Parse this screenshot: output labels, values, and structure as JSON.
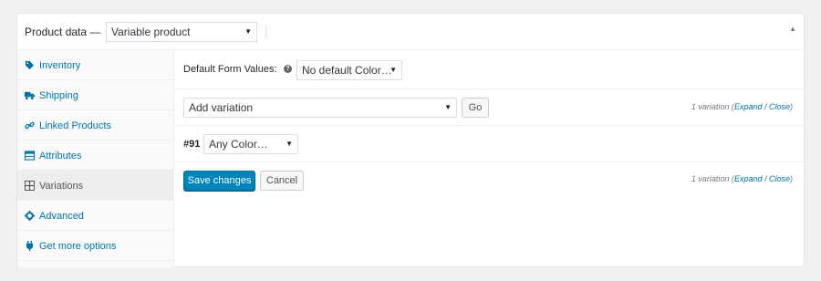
{
  "header": {
    "title": "Product data —",
    "product_type": "Variable product"
  },
  "sidebar": {
    "items": [
      {
        "label": "Inventory",
        "icon": "tag-icon"
      },
      {
        "label": "Shipping",
        "icon": "truck-icon"
      },
      {
        "label": "Linked Products",
        "icon": "link-icon"
      },
      {
        "label": "Attributes",
        "icon": "table-icon"
      },
      {
        "label": "Variations",
        "icon": "grid-icon",
        "active": true
      },
      {
        "label": "Advanced",
        "icon": "gear-icon"
      },
      {
        "label": "Get more options",
        "icon": "plugin-icon"
      }
    ]
  },
  "variations": {
    "default_form_label": "Default Form Values:",
    "help_glyph": "?",
    "default_form_select": "No default Color…",
    "add_variation_select": "Add variation",
    "go_label": "Go",
    "count_prefix": "1 variation (",
    "expand_label": "Expand",
    "link_separator": " / ",
    "close_label": "Close",
    "count_suffix": ")",
    "variation_number": "#91",
    "variation_color_select": "Any Color…",
    "save_label": "Save changes",
    "cancel_label": "Cancel"
  },
  "colors": {
    "primary": "#0085ba",
    "link": "#0073aa"
  }
}
